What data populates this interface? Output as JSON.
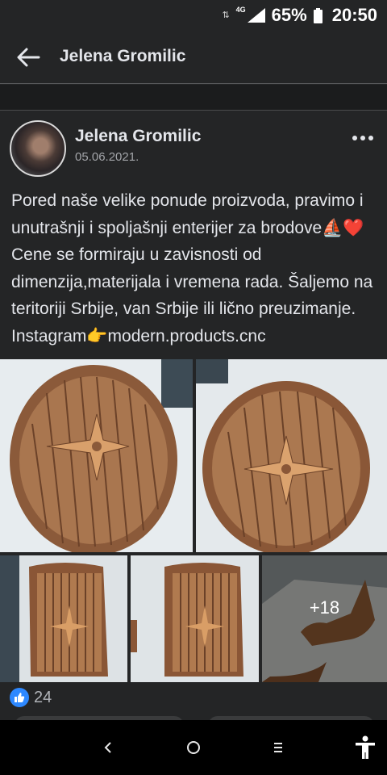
{
  "status_bar": {
    "network": "4G",
    "battery_percent": "65%",
    "time": "20:50"
  },
  "app_bar": {
    "title": "Jelena Gromilic",
    "back_icon": "arrow-left-icon"
  },
  "post": {
    "author": "Jelena Gromilic",
    "date": "05.06.2021.",
    "more_icon": "more-horizontal-icon",
    "text": "Pored naše velike ponude proizvoda, pravimo i unutrašnji i spoljašnji enterijer za brodove⛵❤️ Cene se formiraju u zavisnosti od dimenzija,materijala i vremena rada. Šaljemo na teritoriji Srbije, van Srbije ili lično preuzimanje. Instagram👉modern.products.cnc",
    "photos": [
      {
        "name": "oval-teak-table-photo"
      },
      {
        "name": "oval-teak-table-angled-photo"
      },
      {
        "name": "teak-panel-door-photo"
      },
      {
        "name": "teak-panel-door-2-photo"
      },
      {
        "name": "sailboat-cutout-photo"
      }
    ],
    "more_photos_label": "+18",
    "reactions": {
      "icon": "like-icon",
      "count": "24",
      "color": "#2d88ff"
    }
  },
  "nav_bar": {
    "back_icon": "nav-back-icon",
    "home_icon": "nav-home-icon",
    "recents_icon": "nav-recents-icon",
    "accessibility_icon": "accessibility-icon"
  },
  "colors": {
    "background": "#242526",
    "text": "#e4e6eb",
    "secondary_text": "#a3a5a9",
    "like_blue": "#2d88ff"
  }
}
